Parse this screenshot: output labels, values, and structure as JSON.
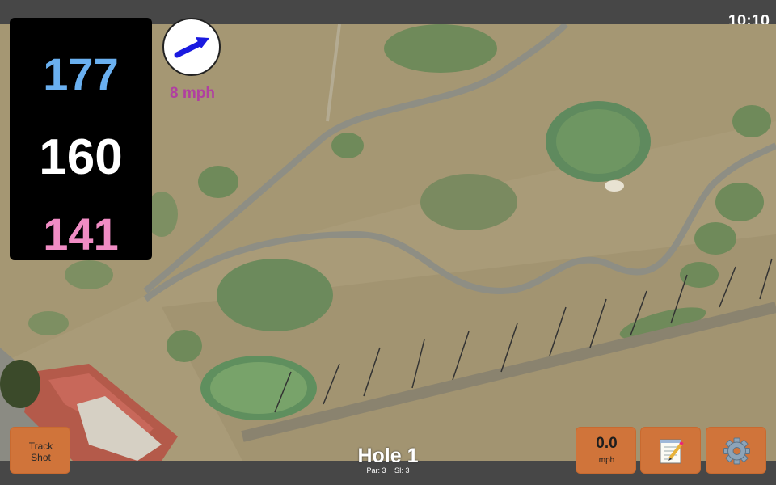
{
  "status_bar": {
    "time": "10:10"
  },
  "distances": {
    "back": "177",
    "middle": "160",
    "front": "141",
    "colors": {
      "back": "#6ab0f0",
      "middle": "#ffffff",
      "front": "#f08cc4"
    }
  },
  "wind": {
    "speed": "8 mph",
    "direction_icon": "arrow-icon",
    "color": "#b040a0",
    "arrow_color": "#1a1ae0"
  },
  "buttons": {
    "track_shot": "Track\nShot",
    "speed_value": "0.0",
    "speed_unit": "mph",
    "notes_icon": "notepad-icon",
    "settings_icon": "gear-icon",
    "accent": "#d0743a"
  },
  "hole": {
    "title": "Hole 1",
    "par": "Par: 3",
    "si": "SI: 3"
  }
}
